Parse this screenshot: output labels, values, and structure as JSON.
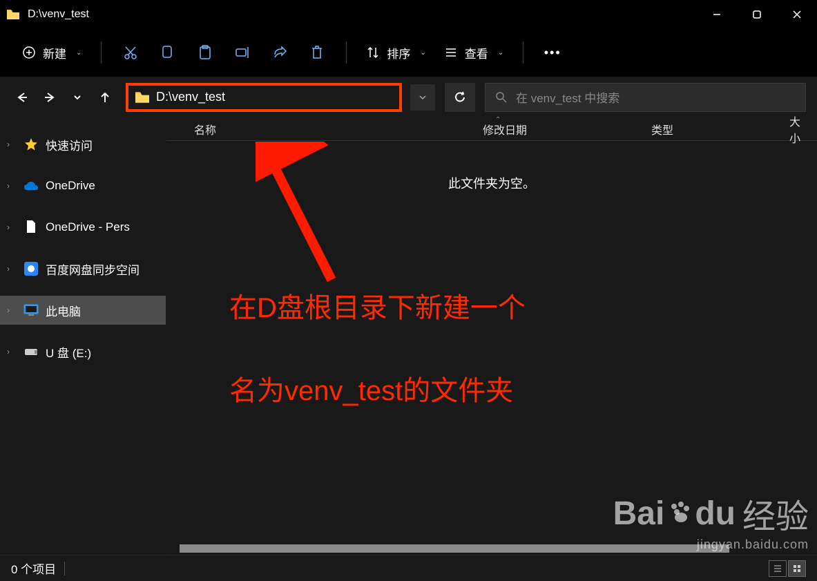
{
  "titlebar": {
    "title": "D:\\venv_test"
  },
  "toolbar": {
    "new_label": "新建",
    "sort_label": "排序",
    "view_label": "查看"
  },
  "navbar": {
    "address": "D:\\venv_test",
    "search_placeholder": "在 venv_test 中搜索"
  },
  "sidebar": {
    "items": [
      {
        "label": "快速访问",
        "icon": "star"
      },
      {
        "label": "OneDrive",
        "icon": "cloud"
      },
      {
        "label": "OneDrive - Pers",
        "icon": "file"
      },
      {
        "label": "百度网盘同步空间",
        "icon": "baidudisk"
      },
      {
        "label": "此电脑",
        "icon": "pc"
      },
      {
        "label": "U 盘 (E:)",
        "icon": "usb"
      }
    ]
  },
  "columns": {
    "name": "名称",
    "modified": "修改日期",
    "type": "类型",
    "size": "大小"
  },
  "main": {
    "empty_message": "此文件夹为空。"
  },
  "annotation": {
    "line1": "在D盘根目录下新建一个",
    "line2": "名为venv_test的文件夹"
  },
  "statusbar": {
    "count": "0 个项目"
  },
  "watermark": {
    "main": "Baidu 经验",
    "sub": "jingyan.baidu.com"
  }
}
